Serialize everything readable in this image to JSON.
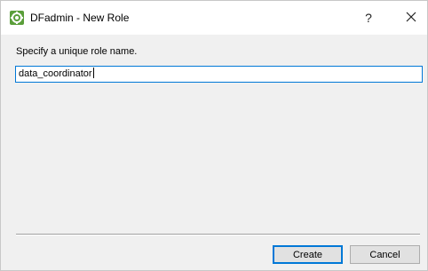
{
  "window": {
    "title": "DFadmin - New Role",
    "help_label": "?",
    "app_icon": "dfadmin-gear-icon",
    "close_icon": "close-icon"
  },
  "dialog": {
    "prompt": "Specify a unique role name.",
    "role_name_value": "data_coordinator"
  },
  "buttons": {
    "create_label": "Create",
    "cancel_label": "Cancel"
  },
  "colors": {
    "focus_accent": "#0078d7",
    "dialog_bg": "#f0f0f0",
    "titlebar_bg": "#ffffff"
  }
}
